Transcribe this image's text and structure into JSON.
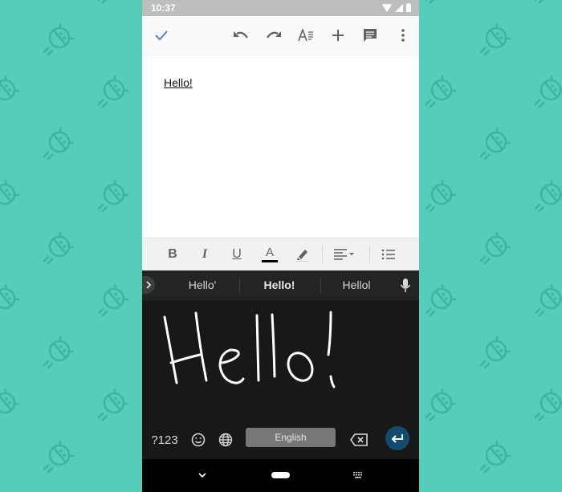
{
  "background": {
    "color": "#55cdbb",
    "pattern_icon": "android-bot-icon"
  },
  "status_bar": {
    "time": "10:37",
    "icons": [
      "wifi-icon",
      "cell-signal-icon",
      "battery-icon"
    ]
  },
  "app_bar": {
    "done_icon": "checkmark-icon",
    "actions": [
      "undo-icon",
      "redo-icon",
      "text-format-icon",
      "insert-icon",
      "comment-icon",
      "more-vert-icon"
    ],
    "accent": "#4a86d8"
  },
  "document": {
    "text": "Hello!"
  },
  "format_toolbar": {
    "items": [
      "bold-icon",
      "italic-icon",
      "underline-icon",
      "text-color-icon",
      "highlight-icon",
      "align-icon",
      "bulleted-list-icon"
    ],
    "labels": {
      "bold": "B",
      "italic": "I",
      "underline": "U",
      "text_color": "A"
    },
    "text_color_swatch": "#000000"
  },
  "keyboard": {
    "suggestions": [
      "Hello'",
      "Hello!",
      "Hellol"
    ],
    "selected_suggestion": "Hello!",
    "handwriting_text": "Hello!",
    "keys": {
      "symbols": "?123",
      "space_label": "English"
    },
    "enter_color": "#114b6e"
  },
  "nav_bar": {
    "buttons": [
      "back-chevron-icon",
      "home-pill-icon",
      "keyboard-switch-icon"
    ]
  }
}
